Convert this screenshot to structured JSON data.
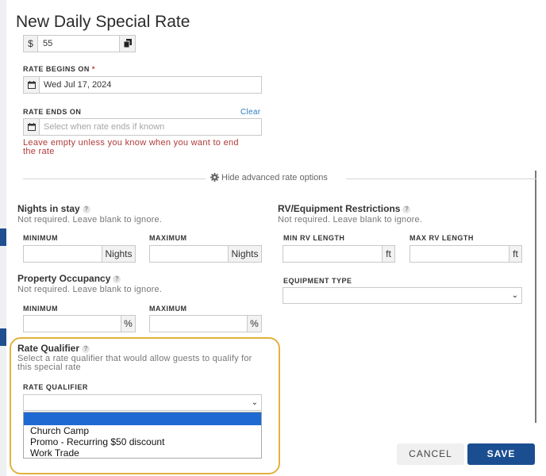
{
  "dialog": {
    "title": "New Daily Special Rate"
  },
  "rate_amount": {
    "currency_symbol": "$",
    "value": "55"
  },
  "rate_begins": {
    "label": "RATE BEGINS ON",
    "required_marker": "*",
    "value": "Wed Jul 17, 2024"
  },
  "rate_ends": {
    "label": "RATE ENDS ON",
    "clear_label": "Clear",
    "placeholder": "Select when rate ends if known",
    "warning_line1": "Leave empty unless you know when you want to end",
    "warning_line2": "the rate"
  },
  "advanced": {
    "toggle_label": "Hide advanced rate options"
  },
  "nights_in_stay": {
    "heading": "Nights in stay",
    "hint": "Not required. Leave blank to ignore.",
    "min_label": "MINIMUM",
    "max_label": "MAXIMUM",
    "unit": "Nights"
  },
  "property_occupancy": {
    "heading": "Property Occupancy",
    "hint": "Not required. Leave blank to ignore.",
    "min_label": "MINIMUM",
    "max_label": "MAXIMUM",
    "unit": "%"
  },
  "rv_restrictions": {
    "heading": "RV/Equipment Restrictions",
    "hint": "Not required. Leave blank to ignore.",
    "min_label": "MIN RV LENGTH",
    "max_label": "MAX RV LENGTH",
    "unit": "ft",
    "equipment_type_label": "EQUIPMENT TYPE"
  },
  "rate_qualifier": {
    "heading": "Rate Qualifier",
    "hint_line1": "Select a rate qualifier that would allow guests to qualify for",
    "hint_line2": "this special rate",
    "field_label": "RATE QUALIFIER",
    "options": [
      "Church Camp",
      "Promo - Recurring $50 discount",
      "Work Trade"
    ]
  },
  "buttons": {
    "cancel": "CANCEL",
    "save": "SAVE"
  },
  "colors": {
    "accent": "#1b4e91",
    "highlight": "#e2b23f",
    "warning": "#b03a3a",
    "link": "#2b7bc0",
    "selected_option": "#1f69d3"
  },
  "icons": {
    "calendar": "calendar-icon",
    "copy": "copy-icon",
    "gear": "gear-icon",
    "help": "help-icon",
    "chevron": "chevron-down-icon"
  }
}
